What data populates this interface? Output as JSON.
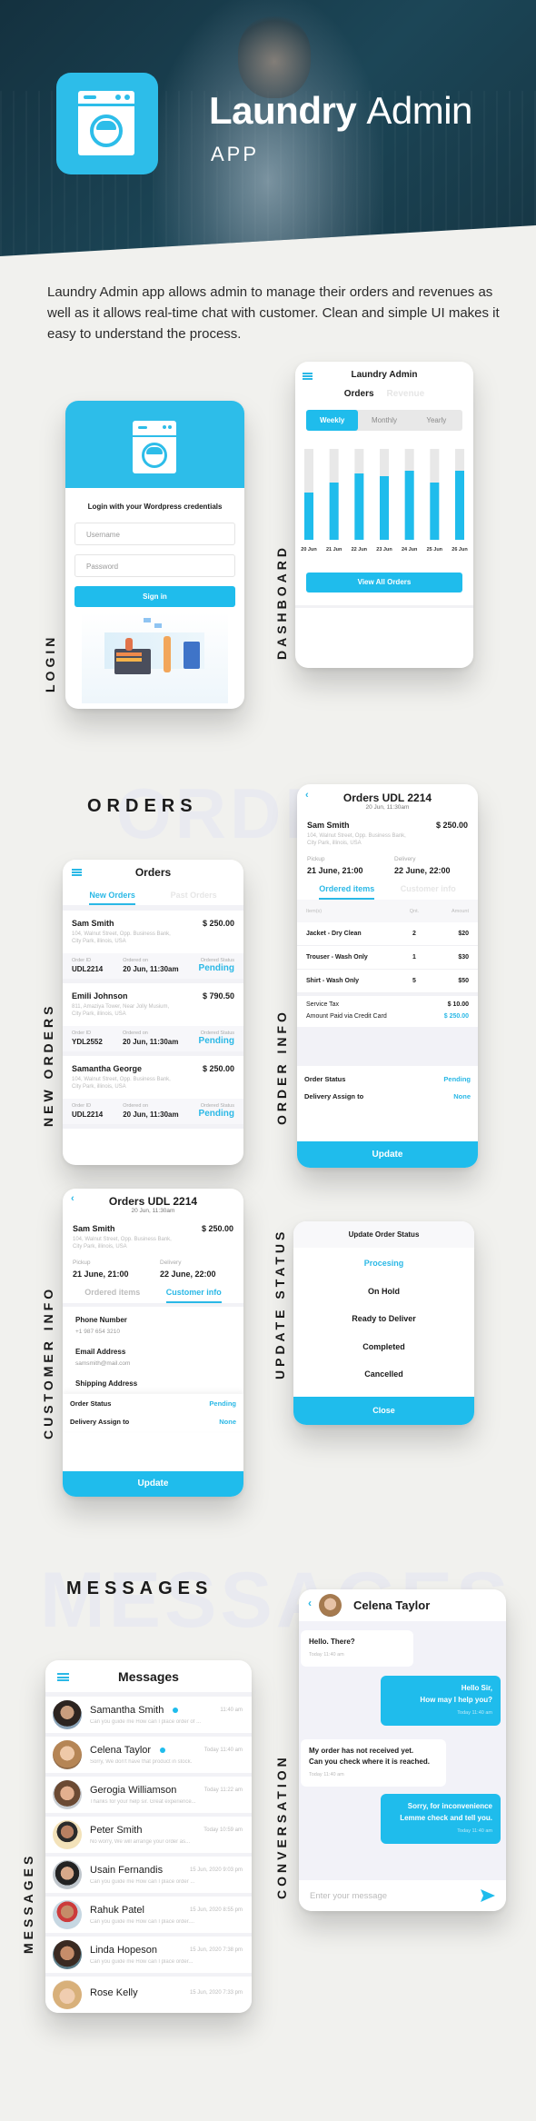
{
  "hero": {
    "title_bold": "Laundry",
    "title_light": "Admin",
    "subtitle": "APP"
  },
  "intro": "Laundry Admin app allows admin to manage their orders and revenues as well as it allows real-time chat with customer. Clean and simple UI makes it easy to understand the process.",
  "section_labels": {
    "login": "LOGIN",
    "dashboard": "DASHBOARD",
    "orders_heading": "ORDERS",
    "orders_ghost": "ORDERS",
    "new_orders": "NEW ORDERS",
    "order_info": "ORDER INFO",
    "customer_info": "CUSTOMER INFO",
    "update_status": "UPDATE STATUS",
    "messages_heading": "MESSAGES",
    "messages_ghost": "MESSAGES",
    "messages": "MESSAGES",
    "conversation": "CONVERSATION"
  },
  "login": {
    "heading": "Login with your Wordpress credentials",
    "username_placeholder": "Username",
    "password_placeholder": "Password",
    "sign_in": "Sign in"
  },
  "dashboard": {
    "title": "Laundry Admin",
    "tabs": [
      "Orders",
      "Revenue"
    ],
    "active_tab": "Orders",
    "periods": [
      "Weekly",
      "Monthly",
      "Yearly"
    ],
    "active_period": "Weekly",
    "view_all": "View All Orders",
    "accent": "#1fbcec"
  },
  "chart_data": {
    "type": "bar",
    "title": "",
    "xlabel": "",
    "ylabel": "",
    "categories": [
      "20 Jun",
      "21 Jun",
      "22 Jun",
      "23 Jun",
      "24 Jun",
      "25 Jun",
      "26 Jun"
    ],
    "values": [
      52,
      63,
      73,
      70,
      76,
      63,
      76
    ],
    "ylim": [
      0,
      100
    ],
    "grid": false,
    "legend": "none"
  },
  "orders": {
    "title": "Orders",
    "tabs": [
      "New Orders",
      "Past Orders"
    ],
    "active_tab": "New Orders",
    "labels": {
      "order_id": "Order ID",
      "ordered_on": "Ordered on",
      "status": "Ordered Status"
    },
    "list": [
      {
        "name": "Sam Smith",
        "amount": "$ 250.00",
        "address_1": "104, Walnut Street, Opp. Business Bank,",
        "address_2": "City Park, illinois, USA",
        "order_id": "UDL2214",
        "ordered_on": "20 Jun, 11:30am",
        "status": "Pending"
      },
      {
        "name": "Emili Johnson",
        "amount": "$ 790.50",
        "address_1": "811, Amaziya Tower,  Near Jolly Musium,",
        "address_2": "City Park, illinois, USA",
        "order_id": "YDL2552",
        "ordered_on": "20 Jun, 11:30am",
        "status": "Pending"
      },
      {
        "name": "Samantha George",
        "amount": "$ 250.00",
        "address_1": "104, Walnut Street, Opp. Business Bank,",
        "address_2": "City Park, illinois, USA",
        "order_id": "UDL2214",
        "ordered_on": "20 Jun, 11:30am",
        "status": "Pending"
      }
    ]
  },
  "order_detail": {
    "title": "Orders UDL 2214",
    "date": "20 Jun, 11:30am",
    "customer": "Sam Smith",
    "amount": "$ 250.00",
    "address_1": "104, Walnut Street, Opp. Business Bank,",
    "address_2": "City Park, illinois, USA",
    "pickup_label": "Pickup",
    "pickup": "21 June, 21:00",
    "delivery_label": "Delivery",
    "delivery": "22 June, 22:00",
    "tabs": [
      "Ordered items",
      "Customer info"
    ],
    "table_headers": [
      "Item(s)",
      "Qnt.",
      "Amount"
    ],
    "items": [
      {
        "name": "Jacket - Dry Clean",
        "qty": "2",
        "amount": "$20"
      },
      {
        "name": "Trouser - Wash Only",
        "qty": "1",
        "amount": "$30"
      },
      {
        "name": "Shirt - Wash Only",
        "qty": "5",
        "amount": "$50"
      }
    ],
    "service_tax_label": "Service Tax",
    "service_tax": "$ 10.00",
    "paid_label": "Amount Paid via Credit Card",
    "paid": "$ 250.00",
    "status_label": "Order Status",
    "status": "Pending",
    "assign_label": "Delivery Assign to",
    "assign": "None",
    "update": "Update"
  },
  "customer_info": {
    "phone_label": "Phone Number",
    "phone": "+1 987 654 3210",
    "email_label": "Email Address",
    "email": "samsmith@mail.com",
    "shipping_label": "Shipping Address"
  },
  "update_status": {
    "title": "Update Order Status",
    "options": [
      "Procesing",
      "On Hold",
      "Ready to Deliver",
      "Completed",
      "Cancelled"
    ],
    "selected": "Procesing",
    "close": "Close"
  },
  "messages": {
    "title": "Messages",
    "list": [
      {
        "name": "Samantha Smith",
        "unread": true,
        "time": "11:40 am",
        "preview": "Can you guide me How can I place order of ..."
      },
      {
        "name": "Celena Taylor",
        "unread": true,
        "time": "Today  11:40 am",
        "preview": "Sorry, We don't have that product in stock."
      },
      {
        "name": "Gerogia Williamson",
        "unread": false,
        "time": "Today  11:22 am",
        "preview": "Thanks for your help sir. Great experience..."
      },
      {
        "name": "Peter Smith",
        "unread": false,
        "time": "Today  10:59 am",
        "preview": "No worry, We will arrange your order as..."
      },
      {
        "name": "Usain Fernandis",
        "unread": false,
        "time": "15 Jun, 2020  9:03 pm",
        "preview": "Can you guide me How can I place order ..."
      },
      {
        "name": "Rahuk Patel",
        "unread": false,
        "time": "15 Jun, 2020  8:55 pm",
        "preview": "Can you guide me How can I place order...."
      },
      {
        "name": "Linda Hopeson",
        "unread": false,
        "time": "15 Jun, 2020  7:38 pm",
        "preview": "Can you guide me How can I place order..."
      },
      {
        "name": "Rose Kelly",
        "unread": false,
        "time": "15 Jun, 2020  7:33 pm",
        "preview": ""
      }
    ]
  },
  "conversation": {
    "contact": "Celena Taylor",
    "messages": [
      {
        "from": "customer",
        "lines": [
          "Hello. There?"
        ],
        "time": "Today  11:40 am"
      },
      {
        "from": "admin",
        "lines": [
          "Hello Sir,",
          "How may I help you?"
        ],
        "time": "Today  11:40 am"
      },
      {
        "from": "customer",
        "lines": [
          "My order has not received yet.",
          "Can you check where it is reached."
        ],
        "time": "Today  11:40 am"
      },
      {
        "from": "admin",
        "lines": [
          "Sorry, for inconvenience",
          "Lemme check and tell you."
        ],
        "time": "Today  11:40 am"
      }
    ],
    "input_placeholder": "Enter your message"
  }
}
